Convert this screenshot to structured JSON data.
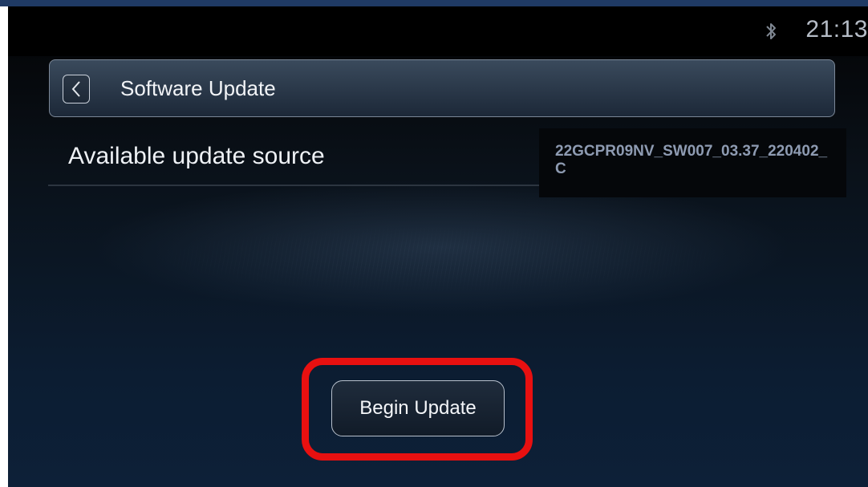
{
  "status_bar": {
    "time": "21:13",
    "bluetooth_icon": "bluetooth-icon"
  },
  "header": {
    "title": "Software Update",
    "back_icon": "chevron-left-icon"
  },
  "update_source": {
    "label": "Available update source",
    "value": "22GCPR09NV_SW007_03.37_220402_C"
  },
  "actions": {
    "begin_update_label": "Begin Update"
  },
  "colors": {
    "highlight": "#e81010",
    "frame_top": "#1f3a64"
  }
}
